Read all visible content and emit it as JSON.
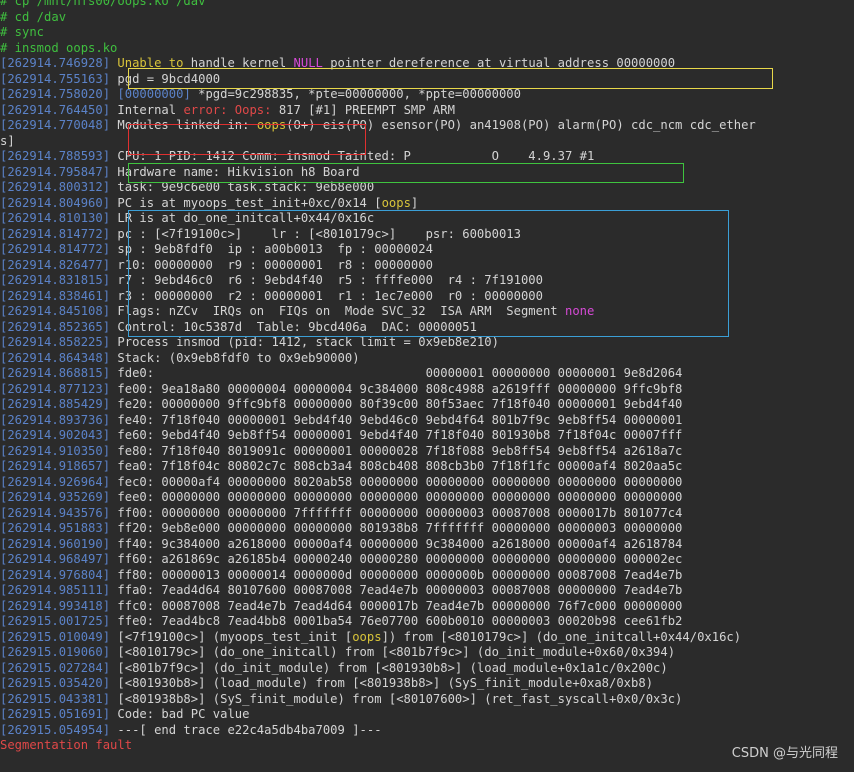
{
  "colors": {
    "background": "#2b2b2b",
    "text": "#d4d4d4",
    "timestamp": "#5b82c8",
    "prompt": "#3fbf3f",
    "error_red": "#e04848",
    "magenta": "#d54ad5",
    "box_yellow": "#e8d84a",
    "box_red": "#e03030",
    "box_green": "#3fc43f",
    "box_blue": "#3b9fd6"
  },
  "lines": [
    {
      "cls": "prompt",
      "segs": [
        {
          "t": "# cp /mnt/nfs00/oops.ko /dav"
        }
      ]
    },
    {
      "cls": "prompt",
      "segs": [
        {
          "t": "# cd /dav"
        }
      ]
    },
    {
      "cls": "prompt",
      "segs": [
        {
          "t": "# sync"
        }
      ]
    },
    {
      "cls": "prompt",
      "segs": [
        {
          "t": "# insmod oops.ko"
        }
      ]
    },
    {
      "ts": "[262914.746928]",
      "segs": [
        {
          "t": " "
        },
        {
          "t": "Unable to",
          "c": "t-yel"
        },
        {
          "t": " handle kernel "
        },
        {
          "t": "NULL",
          "c": "t-mag"
        },
        {
          "t": " pointer dereference at virtual address 00000000"
        }
      ]
    },
    {
      "ts": "[262914.755163]",
      "segs": [
        {
          "t": " pgd = 9bcd4000"
        }
      ]
    },
    {
      "ts": "[262914.758020]",
      "segs": [
        {
          "t": " "
        },
        {
          "t": "[00000000]",
          "c": "ts"
        },
        {
          "t": " *pgd=9c298835, *pte=00000000, *ppte=00000000"
        }
      ]
    },
    {
      "ts": "[262914.764450]",
      "segs": [
        {
          "t": " Internal "
        },
        {
          "t": "error: Oops:",
          "c": "t-red"
        },
        {
          "t": " 817 [#1] PREEMPT SMP ARM"
        }
      ]
    },
    {
      "ts": "[262914.770048]",
      "segs": [
        {
          "t": " Modules linked in: "
        },
        {
          "t": "oops",
          "c": "t-yel"
        },
        {
          "t": "(O+) eis(PO) esensor(PO) an41908(PO) alarm(PO) cdc_ncm cdc_ether"
        }
      ]
    },
    {
      "segs": [
        {
          "t": "s]"
        }
      ]
    },
    {
      "ts": "[262914.788593]",
      "segs": [
        {
          "t": " CPU: 1 PID: 1412 Comm: insmod Tainted: P           O    4.9.37 #1"
        }
      ]
    },
    {
      "ts": "[262914.795847]",
      "segs": [
        {
          "t": " Hardware name: Hikvision h8 Board"
        }
      ]
    },
    {
      "ts": "[262914.800312]",
      "segs": [
        {
          "t": " task: 9e9c6e00 task.stack: 9eb8e000"
        }
      ]
    },
    {
      "ts": "[262914.804960]",
      "segs": [
        {
          "t": " PC is at myoops_test_init+0xc/0x14 ["
        },
        {
          "t": "oops",
          "c": "t-yel"
        },
        {
          "t": "]"
        }
      ]
    },
    {
      "ts": "[262914.810130]",
      "segs": [
        {
          "t": " LR is at do_one_initcall+0x44/0x16c"
        }
      ]
    },
    {
      "ts": "[262914.814772]",
      "segs": [
        {
          "t": " pc : [<7f19100c>]    lr : [<8010179c>]    psr: 600b0013"
        }
      ]
    },
    {
      "ts": "[262914.814772]",
      "segs": [
        {
          "t": " sp : 9eb8fdf0  ip : a00b0013  fp : 00000024"
        }
      ]
    },
    {
      "ts": "[262914.826477]",
      "segs": [
        {
          "t": " r10: 00000000  r9 : 00000001  r8 : 00000000"
        }
      ]
    },
    {
      "ts": "[262914.831815]",
      "segs": [
        {
          "t": " r7 : 9ebd46c0  r6 : 9ebd4f40  r5 : ffffe000  r4 : 7f191000"
        }
      ]
    },
    {
      "ts": "[262914.838461]",
      "segs": [
        {
          "t": " r3 : 00000000  r2 : 00000001  r1 : 1ec7e000  r0 : 00000000"
        }
      ]
    },
    {
      "ts": "[262914.845108]",
      "segs": [
        {
          "t": " Flags: nZCv  IRQs on  FIQs on  Mode SVC_32  ISA ARM  Segment "
        },
        {
          "t": "none",
          "c": "t-mag"
        }
      ]
    },
    {
      "ts": "[262914.852365]",
      "segs": [
        {
          "t": " Control: 10c5387d  Table: 9bcd406a  DAC: 00000051"
        }
      ]
    },
    {
      "ts": "[262914.858225]",
      "segs": [
        {
          "t": " Process insmod (pid: 1412, stack limit = 0x9eb8e210)"
        }
      ]
    },
    {
      "ts": "[262914.864348]",
      "segs": [
        {
          "t": " Stack: (0x9eb8fdf0 to 0x9eb90000)"
        }
      ]
    },
    {
      "ts": "[262914.868815]",
      "segs": [
        {
          "t": " fde0:                                     00000001 00000000 00000001 9e8d2064"
        }
      ]
    },
    {
      "ts": "[262914.877123]",
      "segs": [
        {
          "t": " fe00: 9ea18a80 00000004 00000004 9c384000 808c4988 a2619fff 00000000 9ffc9bf8"
        }
      ]
    },
    {
      "ts": "[262914.885429]",
      "segs": [
        {
          "t": " fe20: 00000000 9ffc9bf8 00000000 80f39c00 80f53aec 7f18f040 00000001 9ebd4f40"
        }
      ]
    },
    {
      "ts": "[262914.893736]",
      "segs": [
        {
          "t": " fe40: 7f18f040 00000001 9ebd4f40 9ebd46c0 9ebd4f64 801b7f9c 9eb8ff54 00000001"
        }
      ]
    },
    {
      "ts": "[262914.902043]",
      "segs": [
        {
          "t": " fe60: 9ebd4f40 9eb8ff54 00000001 9ebd4f40 7f18f040 801930b8 7f18f04c 00007fff"
        }
      ]
    },
    {
      "ts": "[262914.910350]",
      "segs": [
        {
          "t": " fe80: 7f18f040 8019091c 00000001 00000028 7f18f088 9eb8ff54 9eb8ff54 a2618a7c"
        }
      ]
    },
    {
      "ts": "[262914.918657]",
      "segs": [
        {
          "t": " fea0: 7f18f04c 80802c7c 808cb3a4 808cb408 808cb3b0 7f18f1fc 00000af4 8020aa5c"
        }
      ]
    },
    {
      "ts": "[262914.926964]",
      "segs": [
        {
          "t": " fec0: 00000af4 00000000 8020ab58 00000000 00000000 00000000 00000000 00000000"
        }
      ]
    },
    {
      "ts": "[262914.935269]",
      "segs": [
        {
          "t": " fee0: 00000000 00000000 00000000 00000000 00000000 00000000 00000000 00000000"
        }
      ]
    },
    {
      "ts": "[262914.943576]",
      "segs": [
        {
          "t": " ff00: 00000000 00000000 7fffffff 00000000 00000003 00087008 0000017b 801077c4"
        }
      ]
    },
    {
      "ts": "[262914.951883]",
      "segs": [
        {
          "t": " ff20: 9eb8e000 00000000 00000000 801938b8 7fffffff 00000000 00000003 00000000"
        }
      ]
    },
    {
      "ts": "[262914.960190]",
      "segs": [
        {
          "t": " ff40: 9c384000 a2618000 00000af4 00000000 9c384000 a2618000 00000af4 a2618784"
        }
      ]
    },
    {
      "ts": "[262914.968497]",
      "segs": [
        {
          "t": " ff60: a261869c a26185b4 00000240 00000280 00000000 00000000 00000000 000002ec"
        }
      ]
    },
    {
      "ts": "[262914.976804]",
      "segs": [
        {
          "t": " ff80: 00000013 00000014 0000000d 00000000 0000000b 00000000 00087008 7ead4e7b"
        }
      ]
    },
    {
      "ts": "[262914.985111]",
      "segs": [
        {
          "t": " ffa0: 7ead4d64 80107600 00087008 7ead4e7b 00000003 00087008 00000000 7ead4e7b"
        }
      ]
    },
    {
      "ts": "[262914.993418]",
      "segs": [
        {
          "t": " ffc0: 00087008 7ead4e7b 7ead4d64 0000017b 7ead4e7b 00000000 76f7c000 00000000"
        }
      ]
    },
    {
      "ts": "[262915.001725]",
      "segs": [
        {
          "t": " ffe0: 7ead4bc8 7ead4bb8 0001ba54 76e07700 600b0010 00000003 00020b98 cee61fb2"
        }
      ]
    },
    {
      "ts": "[262915.010049]",
      "segs": [
        {
          "t": " [<7f19100c>] (myoops_test_init ["
        },
        {
          "t": "oops",
          "c": "t-yel"
        },
        {
          "t": "]) from [<8010179c>] (do_one_initcall+0x44/0x16c)"
        }
      ]
    },
    {
      "ts": "[262915.019060]",
      "segs": [
        {
          "t": " [<8010179c>] (do_one_initcall) from [<801b7f9c>] (do_init_module+0x60/0x394)"
        }
      ]
    },
    {
      "ts": "[262915.027284]",
      "segs": [
        {
          "t": " [<801b7f9c>] (do_init_module) from [<801930b8>] (load_module+0x1a1c/0x200c)"
        }
      ]
    },
    {
      "ts": "[262915.035420]",
      "segs": [
        {
          "t": " [<801930b8>] (load_module) from [<801938b8>] (SyS_finit_module+0xa8/0xb8)"
        }
      ]
    },
    {
      "ts": "[262915.043381]",
      "segs": [
        {
          "t": " [<801938b8>] (SyS_finit_module) from [<80107600>] (ret_fast_syscall+0x0/0x3c)"
        }
      ]
    },
    {
      "ts": "[262915.051691]",
      "segs": [
        {
          "t": " Code: bad PC value"
        }
      ]
    },
    {
      "ts": "[262915.054954]",
      "segs": [
        {
          "t": " ---[ end trace e22c4a5db4ba7009 ]---"
        }
      ]
    },
    {
      "cls": "t-red",
      "segs": [
        {
          "t": "Segmentation fault"
        }
      ]
    }
  ],
  "watermark": "CSDN @与光同程"
}
